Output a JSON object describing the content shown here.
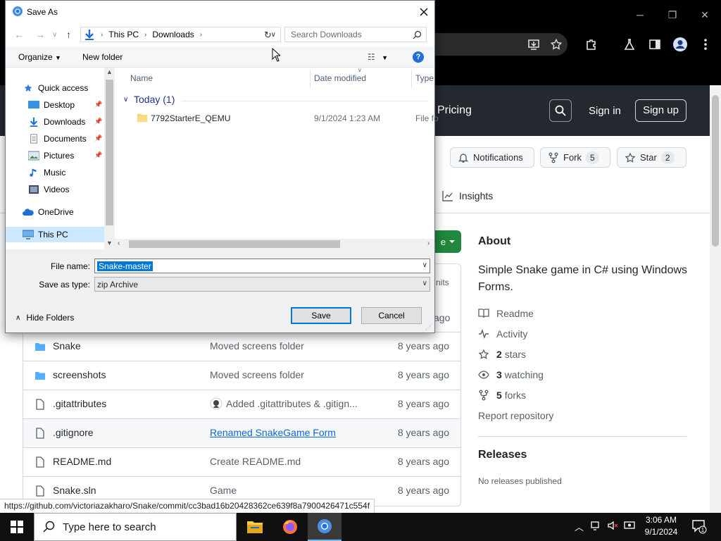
{
  "window_controls": {
    "minimize": "─",
    "maximize": "❐",
    "close": "✕"
  },
  "github": {
    "header": {
      "pricing": "Pricing",
      "sign_in": "Sign in",
      "sign_up": "Sign up"
    },
    "actions": {
      "notifications": "Notifications",
      "fork_label": "Fork",
      "fork_count": "5",
      "star_label": "Star",
      "star_count": "2"
    },
    "tabs": {
      "insights": "Insights"
    },
    "about": {
      "title": "About",
      "description": "Simple Snake game in C# using Windows Forms.",
      "readme": "Readme",
      "activity": "Activity",
      "stars_count": "2",
      "stars_label": "stars",
      "watching_count": "3",
      "watching_label": "watching",
      "forks_count": "5",
      "forks_label": "forks",
      "report": "Report repository"
    },
    "releases": {
      "title": "Releases",
      "empty": "No releases published"
    },
    "partial_texts": {
      "commits": "nits",
      "ago": "ago"
    },
    "files": [
      {
        "name": "Snake",
        "type": "folder",
        "commit": "Moved screens folder",
        "age": "8 years ago"
      },
      {
        "name": "screenshots",
        "type": "folder",
        "commit": "Moved screens folder",
        "age": "8 years ago"
      },
      {
        "name": ".gitattributes",
        "type": "file",
        "commit": "Added .gitattributes & .gitign...",
        "age": "8 years ago"
      },
      {
        "name": ".gitignore",
        "type": "file",
        "commit": "Renamed SnakeGame Form",
        "age": "8 years ago"
      },
      {
        "name": "README.md",
        "type": "file",
        "commit": "Create README.md",
        "age": "8 years ago"
      },
      {
        "name": "Snake.sln",
        "type": "file",
        "commit": "Game",
        "age": "8 years ago"
      }
    ]
  },
  "status_url": "https://github.com/victoriazakharo/Snake/commit/cc3bad16b20428362ce639f8a7900426471c554f",
  "dialog": {
    "title": "Save As",
    "breadcrumb": [
      "This PC",
      "Downloads"
    ],
    "search_placeholder": "Search Downloads",
    "organize": "Organize",
    "new_folder": "New folder",
    "help": "?",
    "nav": {
      "quick_access": "Quick access",
      "desktop": "Desktop",
      "downloads": "Downloads",
      "documents": "Documents",
      "pictures": "Pictures",
      "music": "Music",
      "videos": "Videos",
      "onedrive": "OneDrive",
      "this_pc": "This PC"
    },
    "columns": {
      "name": "Name",
      "date": "Date modified",
      "type": "Type"
    },
    "group": "Today (1)",
    "file": {
      "name": "7792StarterE_QEMU",
      "date": "9/1/2024 1:23 AM",
      "type": "File fo"
    },
    "file_name_label": "File name:",
    "file_name_value": "Snake-master",
    "save_type_label": "Save as type:",
    "save_type_value": "zip Archive",
    "hide_folders": "Hide Folders",
    "save": "Save",
    "cancel": "Cancel"
  },
  "taskbar": {
    "search_placeholder": "Type here to search",
    "time": "3:06 AM",
    "date": "9/1/2024",
    "notification_count": "1"
  },
  "colors": {
    "accent": "#0078d7",
    "github_header": "#24292f",
    "code_green": "#1f883d",
    "link": "#0969da"
  }
}
